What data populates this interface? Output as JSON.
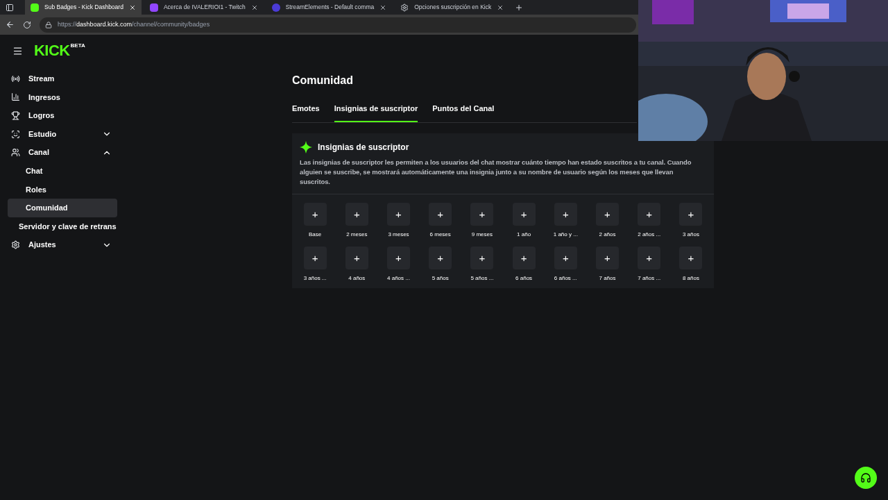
{
  "browser": {
    "tabs": [
      {
        "title": "Sub Badges - Kick Dashboard",
        "selected": true,
        "kind": "kick"
      },
      {
        "title": "Acerca de IVALERIOI1 - Twitch",
        "selected": false,
        "kind": "twitch"
      },
      {
        "title": "StreamElements - Default comma",
        "selected": false,
        "kind": "se"
      },
      {
        "title": "Opciones suscripción en Kick",
        "selected": false,
        "kind": "gear"
      }
    ],
    "url_prefix": "https://",
    "url_host": "dashboard.kick.com",
    "url_path": "/channel/community/badges"
  },
  "logo": {
    "text": "KICK",
    "badge": "BETA"
  },
  "sidebar": {
    "items": [
      {
        "label": "Stream",
        "kind": "stream",
        "selected": false
      },
      {
        "label": "Ingresos",
        "kind": "chart",
        "selected": false
      },
      {
        "label": "Logros",
        "kind": "trophy",
        "selected": false
      },
      {
        "label": "Estudio",
        "kind": "studio",
        "selected": false,
        "expanded": false
      },
      {
        "label": "Canal",
        "kind": "people",
        "selected": false,
        "expanded": true,
        "children": [
          {
            "label": "Chat",
            "selected": false
          },
          {
            "label": "Roles",
            "selected": false
          },
          {
            "label": "Comunidad",
            "selected": true
          }
        ]
      },
      {
        "label": "Servidor y clave de retrans",
        "kind": "plain",
        "selected": false
      },
      {
        "label": "Ajustes",
        "kind": "gear",
        "selected": false,
        "expanded": false
      }
    ]
  },
  "page": {
    "title": "Comunidad",
    "tabs": [
      {
        "label": "Emotes",
        "selected": false
      },
      {
        "label": "Insignias de suscriptor",
        "selected": true
      },
      {
        "label": "Puntos del Canal",
        "selected": false
      }
    ]
  },
  "card": {
    "title": "Insignias de suscriptor",
    "description": "Las insignias de suscriptor les permiten a los usuarios del chat mostrar cuánto tiempo han estado suscritos a tu canal. Cuando alguien se suscribe, se mostrará automáticamente una insignia junto a su nombre de usuario según los meses que llevan suscritos.",
    "add_symbol": "+",
    "badges": [
      "Base",
      "2 meses",
      "3 meses",
      "6 meses",
      "9 meses",
      "1 año",
      "1 año y ...",
      "2 años",
      "2 años ...",
      "3 años",
      "3 años ...",
      "4 años",
      "4 años ...",
      "5 años",
      "5 años ...",
      "6 años",
      "6 años ...",
      "7 años",
      "7 años ...",
      "8 años"
    ]
  }
}
